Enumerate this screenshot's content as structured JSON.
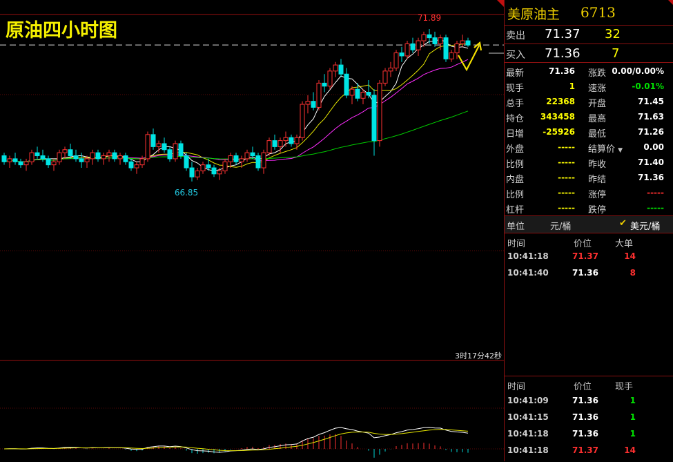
{
  "title_overlay": "原油四小时图",
  "chart_data": {
    "type": "candlestick",
    "title": "原油四小时图",
    "ylim": [
      66.0,
      72.3
    ],
    "last_price_line": 71.36,
    "annotations": [
      {
        "text": "71.89",
        "x_index": 77,
        "value": 71.89
      },
      {
        "text": "66.85",
        "x_index": 33,
        "value": 66.85
      }
    ],
    "countdown": "3时17分42秒",
    "candles": [
      [
        67.7,
        67.8,
        67.4,
        67.5
      ],
      [
        67.5,
        67.7,
        67.3,
        67.6
      ],
      [
        67.6,
        67.8,
        67.4,
        67.5
      ],
      [
        67.5,
        67.6,
        67.3,
        67.4
      ],
      [
        67.4,
        67.6,
        67.2,
        67.5
      ],
      [
        67.5,
        67.9,
        67.4,
        67.8
      ],
      [
        67.8,
        68.0,
        67.6,
        67.7
      ],
      [
        67.7,
        67.9,
        67.5,
        67.6
      ],
      [
        67.6,
        67.7,
        67.3,
        67.4
      ],
      [
        67.4,
        67.6,
        67.2,
        67.5
      ],
      [
        67.5,
        67.9,
        67.4,
        67.8
      ],
      [
        67.8,
        68.0,
        67.6,
        67.9
      ],
      [
        67.9,
        68.1,
        67.6,
        67.7
      ],
      [
        67.7,
        67.9,
        67.5,
        67.6
      ],
      [
        67.6,
        67.8,
        67.3,
        67.5
      ],
      [
        67.5,
        67.7,
        67.3,
        67.6
      ],
      [
        67.6,
        67.9,
        67.4,
        67.8
      ],
      [
        67.8,
        67.9,
        67.5,
        67.6
      ],
      [
        67.6,
        67.8,
        67.4,
        67.7
      ],
      [
        67.7,
        67.9,
        67.5,
        67.8
      ],
      [
        67.8,
        67.9,
        67.5,
        67.6
      ],
      [
        67.6,
        67.8,
        67.4,
        67.7
      ],
      [
        67.7,
        67.8,
        67.4,
        67.5
      ],
      [
        67.5,
        67.6,
        67.2,
        67.3
      ],
      [
        67.3,
        67.5,
        67.1,
        67.4
      ],
      [
        67.4,
        67.7,
        67.3,
        67.6
      ],
      [
        67.6,
        68.5,
        67.5,
        68.4
      ],
      [
        68.4,
        68.6,
        67.9,
        68.0
      ],
      [
        68.0,
        68.2,
        67.8,
        68.1
      ],
      [
        68.1,
        68.3,
        67.8,
        67.9
      ],
      [
        67.9,
        68.0,
        67.5,
        67.6
      ],
      [
        67.6,
        68.2,
        67.5,
        68.1
      ],
      [
        68.1,
        68.2,
        67.6,
        67.7
      ],
      [
        67.7,
        67.8,
        67.2,
        67.3
      ],
      [
        67.3,
        67.5,
        66.85,
        67.0
      ],
      [
        67.0,
        67.3,
        66.9,
        67.2
      ],
      [
        67.2,
        67.5,
        67.1,
        67.4
      ],
      [
        67.4,
        67.6,
        67.2,
        67.3
      ],
      [
        67.3,
        67.4,
        67.0,
        67.1
      ],
      [
        67.1,
        67.3,
        66.9,
        67.2
      ],
      [
        67.2,
        67.6,
        67.1,
        67.5
      ],
      [
        67.5,
        67.8,
        67.3,
        67.7
      ],
      [
        67.7,
        67.8,
        67.4,
        67.5
      ],
      [
        67.5,
        67.7,
        67.3,
        67.6
      ],
      [
        67.6,
        67.9,
        67.5,
        67.8
      ],
      [
        67.8,
        68.0,
        67.6,
        67.7
      ],
      [
        67.7,
        67.8,
        67.2,
        67.3
      ],
      [
        67.3,
        67.9,
        67.1,
        67.8
      ],
      [
        67.8,
        68.3,
        67.7,
        68.2
      ],
      [
        68.2,
        68.4,
        67.9,
        68.0
      ],
      [
        68.0,
        68.3,
        67.8,
        68.2
      ],
      [
        68.2,
        68.5,
        68.0,
        68.3
      ],
      [
        68.3,
        68.4,
        68.0,
        68.1
      ],
      [
        68.1,
        68.4,
        67.9,
        68.3
      ],
      [
        68.3,
        69.5,
        68.2,
        69.4
      ],
      [
        69.4,
        69.7,
        69.1,
        69.5
      ],
      [
        69.5,
        69.8,
        69.2,
        69.3
      ],
      [
        69.3,
        70.2,
        69.2,
        70.1
      ],
      [
        70.1,
        70.4,
        69.8,
        70.0
      ],
      [
        70.0,
        70.6,
        69.9,
        70.5
      ],
      [
        70.5,
        70.8,
        70.3,
        70.7
      ],
      [
        70.7,
        70.9,
        70.3,
        70.4
      ],
      [
        70.4,
        70.6,
        69.6,
        69.7
      ],
      [
        69.7,
        70.0,
        69.4,
        69.9
      ],
      [
        69.9,
        70.1,
        69.5,
        69.6
      ],
      [
        69.6,
        69.9,
        69.4,
        69.8
      ],
      [
        69.8,
        70.2,
        69.6,
        69.7
      ],
      [
        69.7,
        69.9,
        67.7,
        68.2
      ],
      [
        68.2,
        70.2,
        68.0,
        70.1
      ],
      [
        70.1,
        70.6,
        70.0,
        70.5
      ],
      [
        70.5,
        70.8,
        70.3,
        70.6
      ],
      [
        70.6,
        71.2,
        70.5,
        71.1
      ],
      [
        71.1,
        71.3,
        70.8,
        71.0
      ],
      [
        71.0,
        71.5,
        70.9,
        71.4
      ],
      [
        71.4,
        71.6,
        71.1,
        71.2
      ],
      [
        71.2,
        71.6,
        71.0,
        71.5
      ],
      [
        71.5,
        71.8,
        71.3,
        71.7
      ],
      [
        71.7,
        71.89,
        71.4,
        71.6
      ],
      [
        71.6,
        71.8,
        71.3,
        71.4
      ],
      [
        71.4,
        71.7,
        71.2,
        71.6
      ],
      [
        71.6,
        71.7,
        70.8,
        70.9
      ],
      [
        70.9,
        71.2,
        70.8,
        71.1
      ],
      [
        71.1,
        71.5,
        70.9,
        71.4
      ],
      [
        71.4,
        71.7,
        71.3,
        71.5
      ],
      [
        71.5,
        71.6,
        71.3,
        71.36
      ]
    ],
    "ma_lines": [
      {
        "color": "#ffffff"
      },
      {
        "color": "#e6e600"
      },
      {
        "color": "#ff2dff"
      },
      {
        "color": "#00d000"
      }
    ]
  },
  "quote": {
    "name": "美原油主",
    "code": "6713",
    "sell_label": "卖出",
    "sell_price": "71.37",
    "sell_vol": "32",
    "buy_label": "买入",
    "buy_price": "71.36",
    "buy_vol": "7",
    "rows": [
      {
        "l1": "最新",
        "v1": "71.36",
        "c1": "#ffffff",
        "l2": "涨跌",
        "v2": "0.00/0.00%",
        "c2": "#ffffff"
      },
      {
        "l1": "现手",
        "v1": "1",
        "c1": "#ffff00",
        "l2": "速涨",
        "v2": "-0.01%",
        "c2": "#00e000"
      },
      {
        "l1": "总手",
        "v1": "22368",
        "c1": "#ffff00",
        "l2": "开盘",
        "v2": "71.45",
        "c2": "#ffffff"
      },
      {
        "l1": "持仓",
        "v1": "343458",
        "c1": "#ffff00",
        "l2": "最高",
        "v2": "71.63",
        "c2": "#ffffff"
      },
      {
        "l1": "日增",
        "v1": "-25926",
        "c1": "#ffff00",
        "l2": "最低",
        "v2": "71.26",
        "c2": "#ffffff"
      },
      {
        "l1": "外盘",
        "v1": "-----",
        "c1": "#ffff00",
        "l2": "结算价",
        "v2": "0.00",
        "c2": "#ffffff"
      },
      {
        "l1": "比例",
        "v1": "-----",
        "c1": "#ffff00",
        "l2": "昨收",
        "v2": "71.40",
        "c2": "#ffffff"
      },
      {
        "l1": "内盘",
        "v1": "-----",
        "c1": "#ffff00",
        "l2": "昨结",
        "v2": "71.36",
        "c2": "#ffffff"
      },
      {
        "l1": "比例",
        "v1": "-----",
        "c1": "#ffff00",
        "l2": "涨停",
        "v2": "-----",
        "c2": "#ff3030"
      },
      {
        "l1": "杠杆",
        "v1": "-----",
        "c1": "#ffff00",
        "l2": "跌停",
        "v2": "-----",
        "c2": "#00e000"
      }
    ],
    "unit_label": "单位",
    "unit_value": "元/桶",
    "unit_option": "美元/桶",
    "big_orders": {
      "headers": [
        "时间",
        "价位",
        "大单"
      ],
      "items": [
        {
          "time": "10:41:18",
          "price": "71.37",
          "price_color": "#ff3030",
          "vol": "14",
          "vol_color": "#ff3030"
        },
        {
          "time": "10:41:40",
          "price": "71.36",
          "price_color": "#ffffff",
          "vol": "8",
          "vol_color": "#ff3030"
        }
      ]
    },
    "ticks": {
      "headers": [
        "时间",
        "价位",
        "现手"
      ],
      "items": [
        {
          "time": "10:41:09",
          "price": "71.36",
          "price_color": "#ffffff",
          "vol": "1",
          "vol_color": "#00e000"
        },
        {
          "time": "10:41:15",
          "price": "71.36",
          "price_color": "#ffffff",
          "vol": "1",
          "vol_color": "#00e000"
        },
        {
          "time": "10:41:18",
          "price": "71.36",
          "price_color": "#ffffff",
          "vol": "1",
          "vol_color": "#00e000"
        },
        {
          "time": "10:41:18",
          "price": "71.37",
          "price_color": "#ff3030",
          "vol": "14",
          "vol_color": "#ff3030"
        }
      ]
    }
  }
}
